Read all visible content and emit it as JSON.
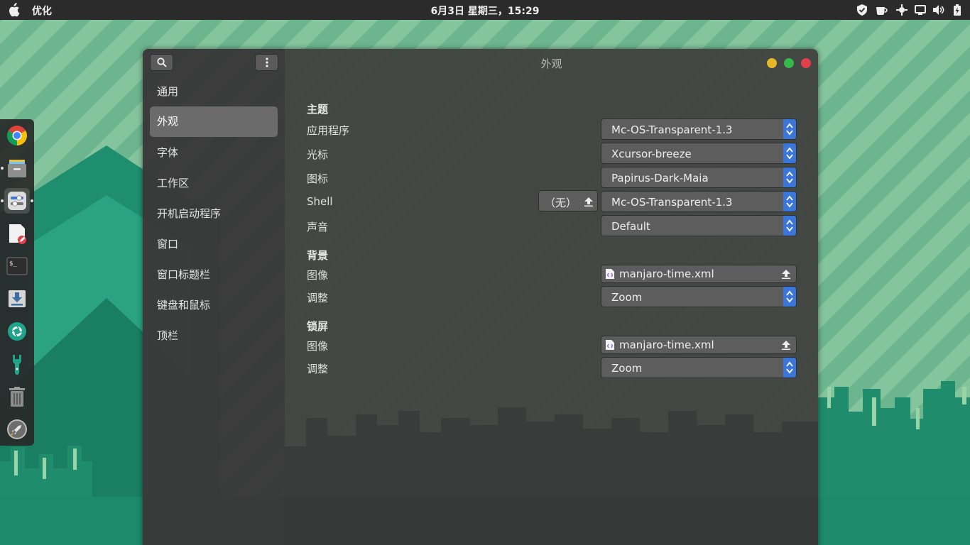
{
  "topbar": {
    "app_name": "优化",
    "clock": "6月3日 星期三，15:29",
    "tray_icons": [
      "shield-icon",
      "cup-icon",
      "network-icon",
      "screen-icon",
      "volume-icon",
      "battery-icon"
    ]
  },
  "dock": {
    "items": [
      {
        "name": "chrome-icon"
      },
      {
        "name": "files-icon"
      },
      {
        "name": "tweaks-icon",
        "active": true
      },
      {
        "name": "text-editor-icon"
      },
      {
        "name": "terminal-icon",
        "text": "$_"
      },
      {
        "name": "download-icon"
      },
      {
        "name": "camera-shutter-icon"
      },
      {
        "name": "settings-wrench-icon"
      },
      {
        "name": "trash-icon"
      },
      {
        "name": "rocket-icon"
      }
    ]
  },
  "window": {
    "title": "外观",
    "sidebar": {
      "items": [
        {
          "label": "通用"
        },
        {
          "label": "外观",
          "selected": true
        },
        {
          "label": "字体"
        },
        {
          "label": "工作区"
        },
        {
          "label": "开机启动程序"
        },
        {
          "label": "窗口"
        },
        {
          "label": "窗口标题栏"
        },
        {
          "label": "键盘和鼠标"
        },
        {
          "label": "顶栏"
        }
      ]
    },
    "theme": {
      "title": "主题",
      "applications": {
        "label": "应用程序",
        "value": "Mc-OS-Transparent-1.3"
      },
      "cursor": {
        "label": "光标",
        "value": "Xcursor-breeze"
      },
      "icons": {
        "label": "图标",
        "value": "Papirus-Dark-Maia"
      },
      "shell": {
        "label": "Shell",
        "none_label": "（无）",
        "value": "Mc-OS-Transparent-1.3"
      },
      "sound": {
        "label": "声音",
        "value": "Default"
      }
    },
    "background": {
      "title": "背景",
      "image": {
        "label": "图像",
        "value": "manjaro-time.xml"
      },
      "adjust": {
        "label": "调整",
        "value": "Zoom"
      }
    },
    "lockscreen": {
      "title": "锁屏",
      "image": {
        "label": "图像",
        "value": "manjaro-time.xml"
      },
      "adjust": {
        "label": "调整",
        "value": "Zoom"
      }
    }
  },
  "colors": {
    "accent": "#3b77d8",
    "close": "#e0404a",
    "minimize": "#e5b62a",
    "maximize": "#36b84a",
    "wallpaper_teal": "#1e8a6c"
  }
}
